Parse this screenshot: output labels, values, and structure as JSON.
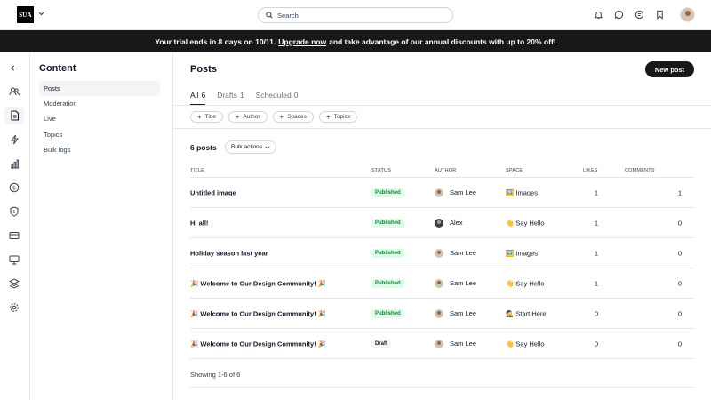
{
  "brand": {
    "logo_text": "SUA",
    "accent": "#18181b"
  },
  "search": {
    "placeholder": "Search"
  },
  "banner": {
    "pre": "Your trial ends in 8 days on 10/11.",
    "link": "Upgrade now",
    "post": "and take advantage of our annual discounts with up to 20% off!"
  },
  "subnav": {
    "title": "Content",
    "items": [
      {
        "label": "Posts"
      },
      {
        "label": "Moderation"
      },
      {
        "label": "Live"
      },
      {
        "label": "Topics"
      },
      {
        "label": "Bulk logs"
      }
    ]
  },
  "main": {
    "title": "Posts",
    "new_post": "New post",
    "tabs": [
      {
        "label": "All",
        "count": "6"
      },
      {
        "label": "Drafts",
        "count": "1"
      },
      {
        "label": "Scheduled",
        "count": "0"
      }
    ],
    "filters": [
      "Title",
      "Author",
      "Spaces",
      "Topics"
    ],
    "count_label": "6 posts",
    "bulk_actions": "Bulk actions",
    "columns": {
      "title": "TITLE",
      "status": "STATUS",
      "author": "AUTHOR",
      "space": "SPACE",
      "likes": "LIKES",
      "comments": "COMMENTS"
    },
    "rows": [
      {
        "title": "Untitled image",
        "status": "Published",
        "author": "Sam Lee",
        "space": "🖼️ Images",
        "likes": "1",
        "comments": "1"
      },
      {
        "title": "Hi all!",
        "status": "Published",
        "author": "Alex",
        "space": "👋 Say Hello",
        "likes": "1",
        "comments": "0"
      },
      {
        "title": "Holiday season last year",
        "status": "Published",
        "author": "Sam Lee",
        "space": "🖼️ Images",
        "likes": "1",
        "comments": "0"
      },
      {
        "title": "🎉 Welcome to Our Design Community! 🎉",
        "status": "Published",
        "author": "Sam Lee",
        "space": "👋 Say Hello",
        "likes": "1",
        "comments": "0"
      },
      {
        "title": "🎉 Welcome to Our Design Community! 🎉",
        "status": "Published",
        "author": "Sam Lee",
        "space": "🕵️ Start Here",
        "likes": "0",
        "comments": "0"
      },
      {
        "title": "🎉 Welcome to Our Design Community! 🎉",
        "status": "Draft",
        "author": "Sam Lee",
        "space": "👋 Say Hello",
        "likes": "0",
        "comments": "0"
      }
    ],
    "showing": "Showing 1-6 of 6"
  },
  "icons": {
    "rail": [
      "back-arrow-icon",
      "members-icon",
      "content-icon",
      "activity-icon",
      "analytics-icon",
      "billing-icon",
      "security-icon",
      "card-icon",
      "display-icon",
      "layers-icon",
      "settings-icon"
    ],
    "top": [
      "bell-icon",
      "chat-icon",
      "messages-icon",
      "bookmark-icon"
    ]
  }
}
